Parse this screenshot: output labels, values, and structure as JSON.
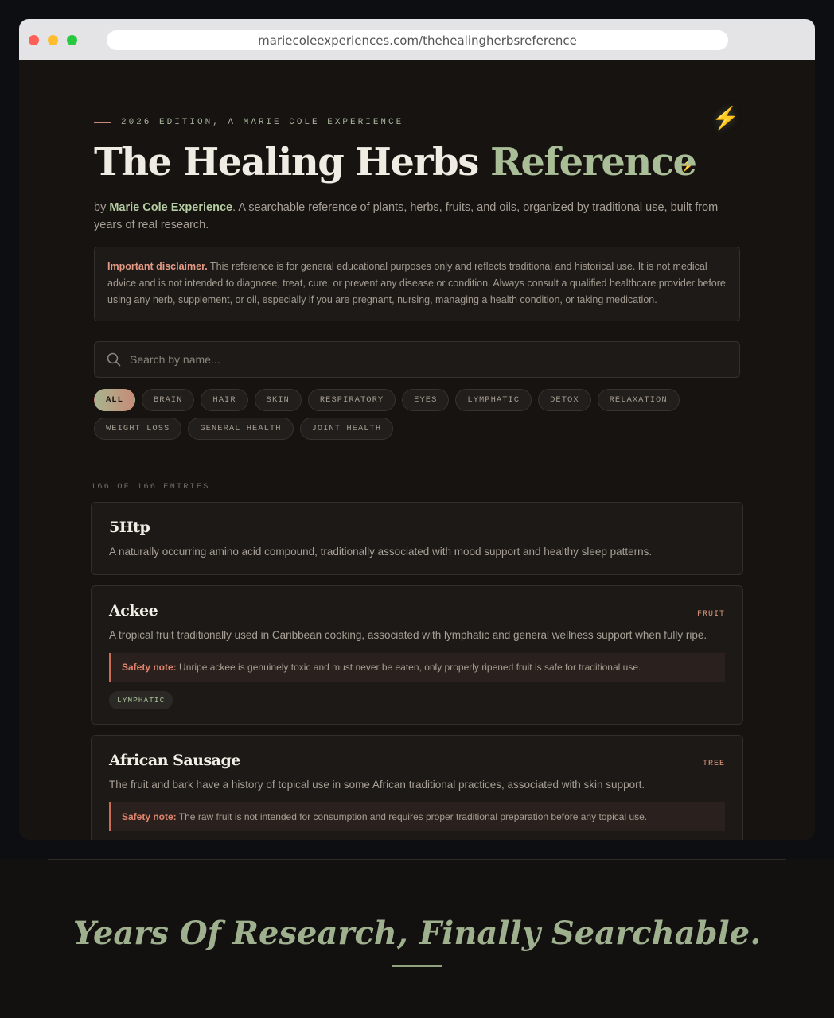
{
  "browser": {
    "url": "mariecoleexperiences.com/thehealingherbsreference"
  },
  "header": {
    "eyebrow": "2026 EDITION, A MARIE COLE EXPERIENCE",
    "title_main": "The Healing Herbs ",
    "title_accent": "Reference",
    "byline_prefix": "by ",
    "byline_author": "Marie Cole Experience",
    "byline_text": ". A searchable reference of plants, herbs, fruits, and oils, organized by traditional use, built from years of real research.",
    "bolt_glyph": "⚡"
  },
  "disclaimer": {
    "label": "Important disclaimer.",
    "text": " This reference is for general educational purposes only and reflects traditional and historical use. It is not medical advice and is not intended to diagnose, treat, cure, or prevent any disease or condition. Always consult a qualified healthcare provider before using any herb, supplement, or oil, especially if you are pregnant, nursing, managing a health condition, or taking medication."
  },
  "search": {
    "placeholder": "Search by name..."
  },
  "filters": [
    "ALL",
    "BRAIN",
    "HAIR",
    "SKIN",
    "RESPIRATORY",
    "EYES",
    "LYMPHATIC",
    "DETOX",
    "RELAXATION",
    "WEIGHT LOSS",
    "GENERAL HEALTH",
    "JOINT HEALTH"
  ],
  "results": {
    "count": "166 OF 166 ENTRIES"
  },
  "entries": [
    {
      "name": "5Htp",
      "type": "",
      "desc": "A naturally occurring amino acid compound, traditionally associated with mood support and healthy sleep patterns.",
      "safety_label": "",
      "safety": "",
      "tag": ""
    },
    {
      "name": "Ackee",
      "type": "FRUIT",
      "desc": "A tropical fruit traditionally used in Caribbean cooking, associated with lymphatic and general wellness support when fully ripe.",
      "safety_label": "Safety note:",
      "safety": " Unripe ackee is genuinely toxic and must never be eaten, only properly ripened fruit is safe for traditional use.",
      "tag": "LYMPHATIC"
    },
    {
      "name": "African Sausage",
      "type": "TREE",
      "desc": "The fruit and bark have a history of topical use in some African traditional practices, associated with skin support.",
      "safety_label": "Safety note:",
      "safety": " The raw fruit is not intended for consumption and requires proper traditional preparation before any topical use.",
      "tag": ""
    }
  ],
  "footer": {
    "tagline": "Years Of Research, Finally Searchable."
  },
  "colors": {
    "accent_green": "#a9bd97",
    "accent_coral": "#e09a7e",
    "background": "#161311"
  }
}
